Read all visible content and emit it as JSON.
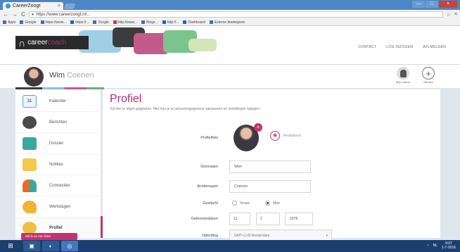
{
  "browser": {
    "tab_title": "CareerZoogt",
    "tab_close": "×",
    "url": "https://www.careerzoogt.nl/...",
    "nav_back": "←",
    "nav_forward": "→",
    "nav_reload": "C",
    "bookmarks": [
      "Apps",
      "Google",
      "https://www...",
      "https://...",
      "Zoogle",
      "http://www...",
      "Blogs...",
      "http://...",
      "Dashboard",
      "Externe bladwijzers"
    ]
  },
  "window_controls": {
    "minimize": "—",
    "maximize": "□",
    "close": "×"
  },
  "header": {
    "logo_text": "career",
    "logo_sub": "coach",
    "nav": [
      "CONTACT",
      "LOG INZOGEN",
      "AFLMELDEN"
    ]
  },
  "userbar": {
    "first_name": "Wim",
    "last_name": "Coenen",
    "profile_label": "Mijn Career",
    "add_label": "Nieuwe"
  },
  "sidebar": {
    "items": [
      {
        "label": "Kalender",
        "color": "#5aa4d6"
      },
      {
        "label": "Berichten",
        "color": "#4a4a4a"
      },
      {
        "label": "Dossier",
        "color": "#3aa89a"
      },
      {
        "label": "Notities",
        "color": "#f2c94c"
      },
      {
        "label": "Connecties",
        "color": "#e46b2c"
      },
      {
        "label": "Werkdagen",
        "color": "#f2b233"
      },
      {
        "label": "Profiel",
        "color": "#f0c040"
      }
    ],
    "calendar_day": "31"
  },
  "main": {
    "title": "Profiel",
    "subtitle": "Vul hier je eigen gegevens. Hier kun je je persoonsgegevens aanpassen en instellingen wijzigen.",
    "photo_label": "Profielfoto",
    "photo_badge": "+",
    "photo_action": "Verwijderen",
    "fields": {
      "first_name_label": "Voornaam",
      "first_name_value": "Wim",
      "last_name_label": "Achternaam",
      "last_name_value": "Coenen",
      "gender_label": "Geslacht",
      "gender_options": [
        "Vrouw",
        "Man"
      ],
      "birthdate_label": "Geboortedatum",
      "birth_day": "11",
      "birth_month": "1",
      "birth_year": "1976",
      "select_label": "Opleiding",
      "select_value": "GMT+1:00 Amsterdam"
    }
  },
  "float_button": "Wil ik nu een links",
  "taskbar": {
    "start": "⊞",
    "tray_left": "NL",
    "time": "9:07",
    "date": "1-7-2016"
  },
  "colors": {
    "accent": "#b12a71",
    "browser_blue": "#4d86c4",
    "taskbar": "#1b3f70"
  }
}
